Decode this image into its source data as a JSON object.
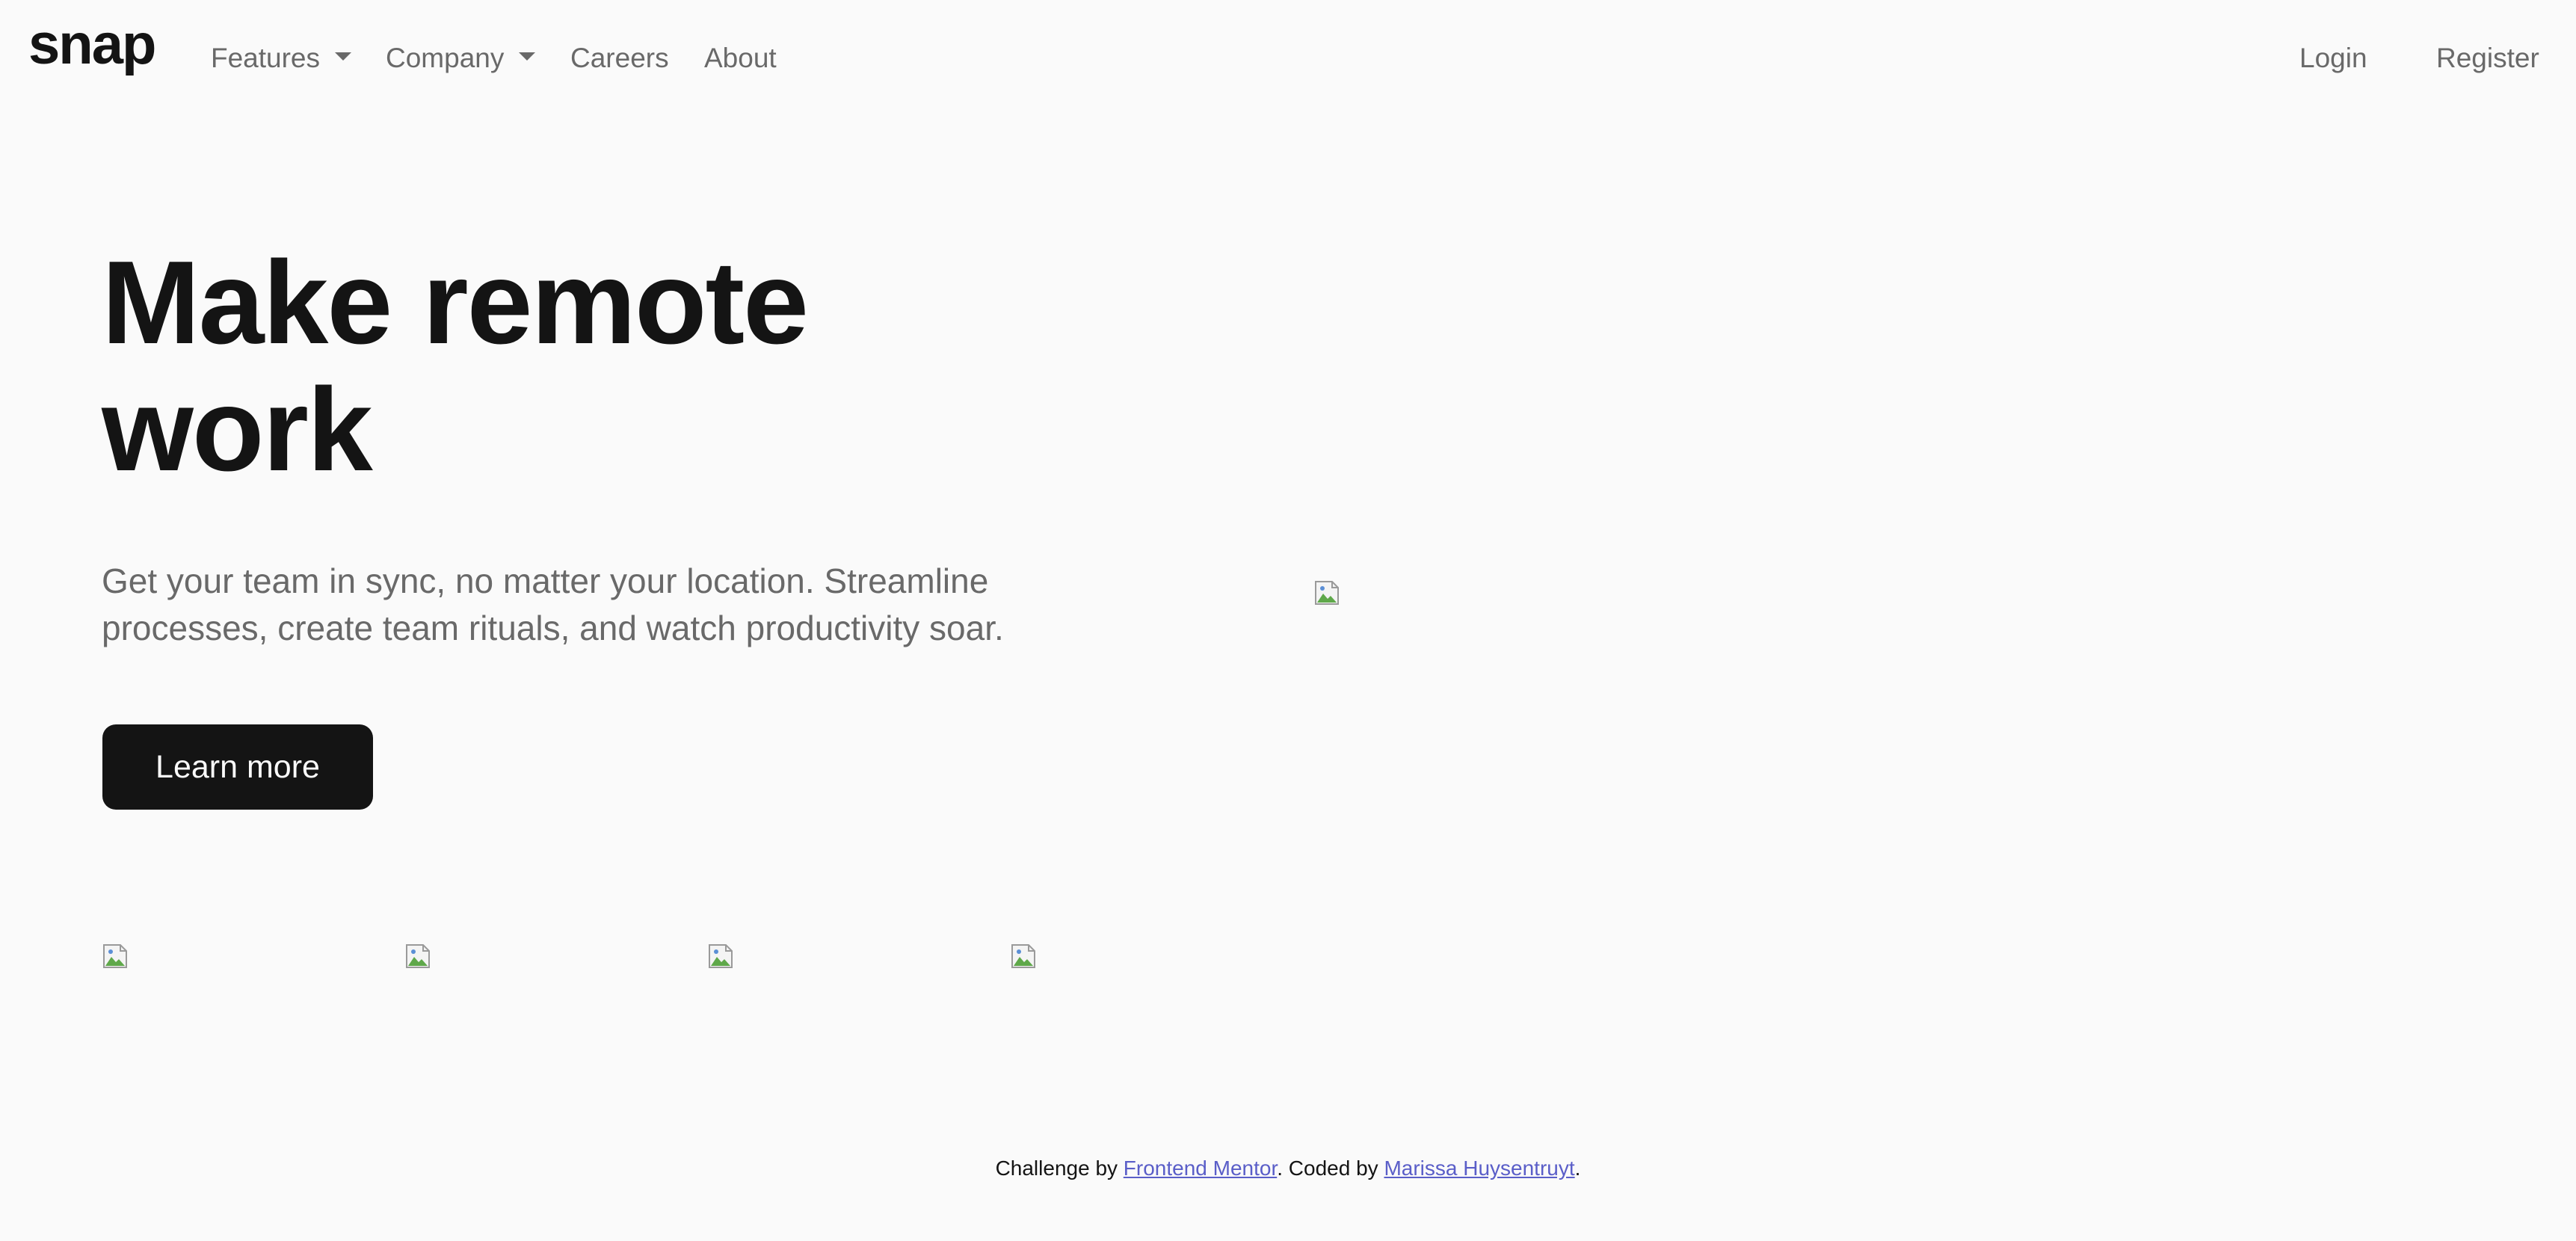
{
  "header": {
    "logo": "snap",
    "nav": [
      {
        "label": "Features",
        "dropdown": true
      },
      {
        "label": "Company",
        "dropdown": true
      },
      {
        "label": "Careers",
        "dropdown": false
      },
      {
        "label": "About",
        "dropdown": false
      }
    ],
    "login_label": "Login",
    "register_label": "Register"
  },
  "hero": {
    "title": "Make remote work",
    "subtitle": "Get your team in sync, no matter your location. Streamline processes, create team rituals, and watch productivity soar.",
    "cta_label": "Learn more"
  },
  "images": {
    "hero_image": "broken-image-icon",
    "client_logos": [
      "broken-image-icon",
      "broken-image-icon",
      "broken-image-icon",
      "broken-image-icon"
    ]
  },
  "footer": {
    "prefix": "Challenge by ",
    "challenge_link": "Frontend Mentor",
    "middle": ". Coded by ",
    "author_link": "Marissa Huysentruyt",
    "suffix": "."
  },
  "colors": {
    "background": "#fafafa",
    "text_dark": "#141414",
    "text_muted": "#696969",
    "link": "#5a5ec8"
  }
}
